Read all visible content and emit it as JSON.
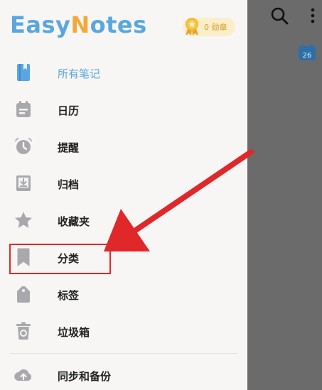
{
  "app": {
    "brand_part1": "Easy",
    "brand_part2": "N",
    "brand_part3": "otes",
    "medal_text": "0 勋章"
  },
  "calendar_badge_day": "26",
  "menu": {
    "items": [
      {
        "label": "所有笔记",
        "icon": "notebook-icon",
        "active": true
      },
      {
        "label": "日历",
        "icon": "calendar-icon"
      },
      {
        "label": "提醒",
        "icon": "alarm-clock-icon"
      },
      {
        "label": "归档",
        "icon": "archive-icon"
      },
      {
        "label": "收藏夹",
        "icon": "star-icon"
      },
      {
        "label": "分类",
        "icon": "bookmark-icon"
      },
      {
        "label": "标签",
        "icon": "tag-icon"
      },
      {
        "label": "垃圾箱",
        "icon": "trash-icon"
      },
      {
        "label": "同步和备份",
        "icon": "cloud-upload-icon"
      }
    ]
  },
  "colors": {
    "accent": "#5aa6de",
    "brand_orange": "#f2a93b",
    "annotation_red": "#e0272a",
    "icon_gray": "#a9a9ad"
  }
}
